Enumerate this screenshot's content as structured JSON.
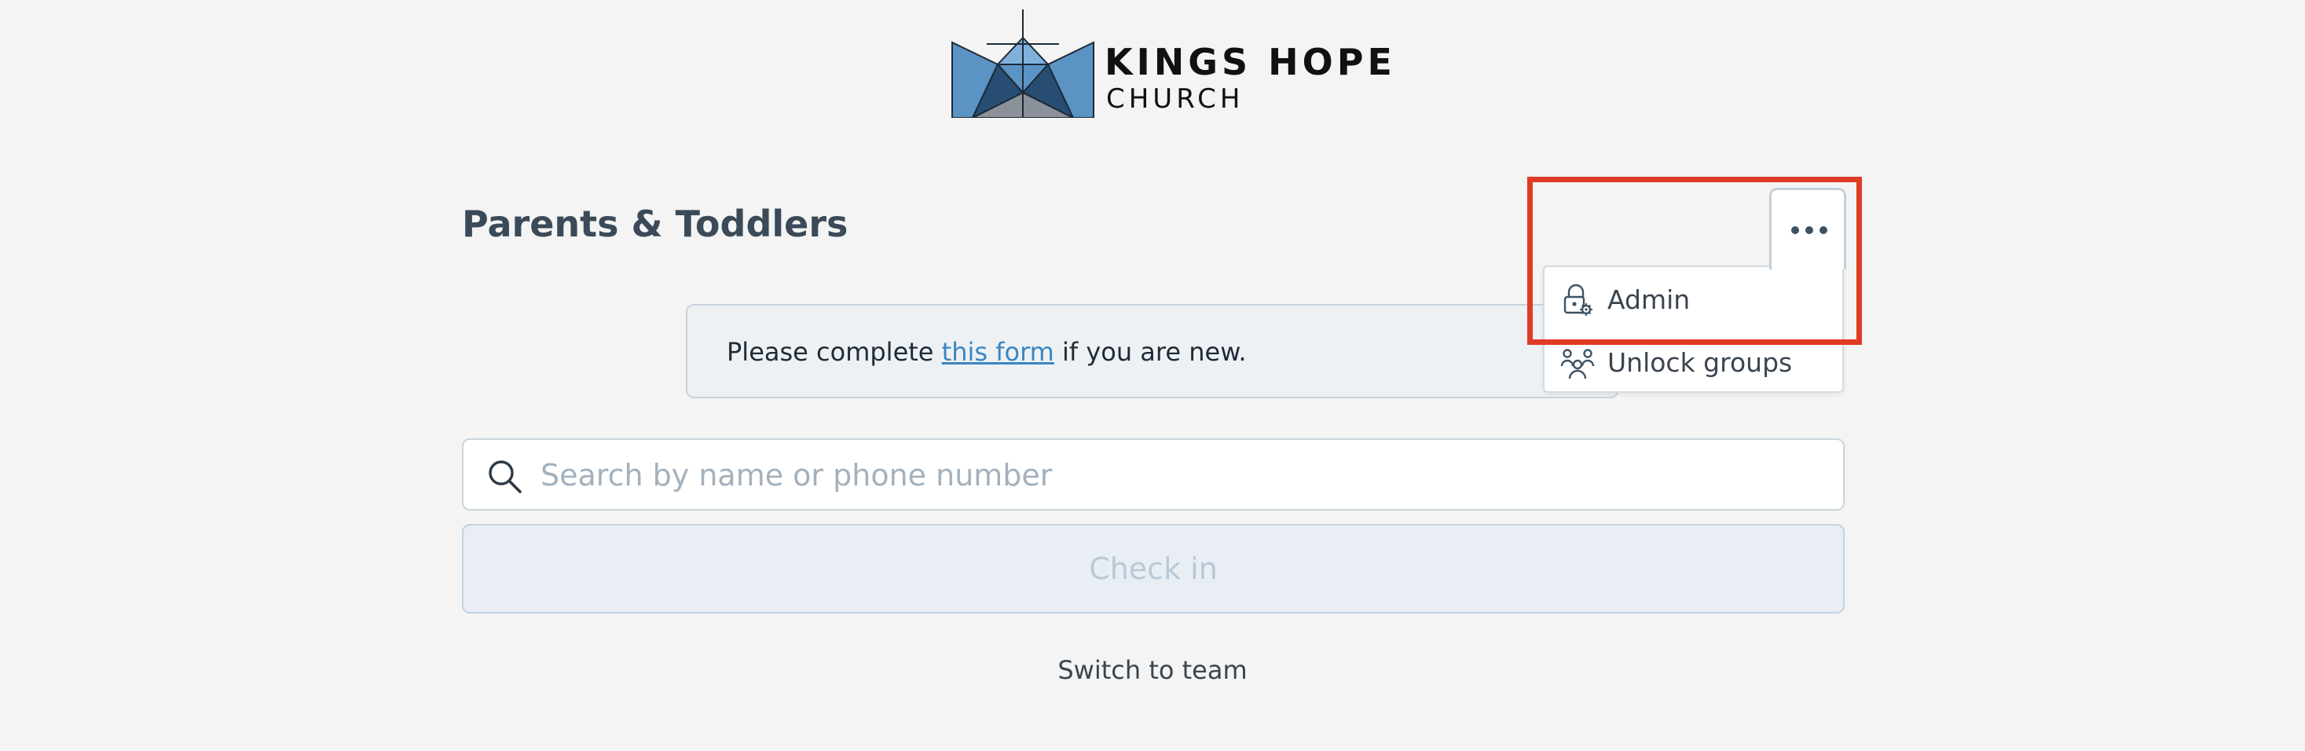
{
  "logo": {
    "line1": "KINGS HOPE",
    "line2": "CHURCH"
  },
  "page_title": "Parents & Toddlers",
  "notice": {
    "prefix": "Please complete ",
    "link_text": "this form",
    "suffix": " if you are new."
  },
  "search": {
    "placeholder": "Search by name or phone number",
    "value": "",
    "icon": "search-icon"
  },
  "checkin_label": "Check in",
  "switch_team_label": "Switch to team",
  "more_menu": {
    "button_icon": "more-horizontal-icon",
    "items": [
      {
        "label": "Admin",
        "icon": "lock-gear-icon"
      },
      {
        "label": "Unlock groups",
        "icon": "group-users-icon"
      }
    ]
  },
  "colors": {
    "background": "#f3f4f3",
    "title": "#3b4a58",
    "link": "#3b86c2",
    "highlight": "#e03b24",
    "logo_blue": "#5b93c5",
    "logo_dark": "#274e72"
  }
}
